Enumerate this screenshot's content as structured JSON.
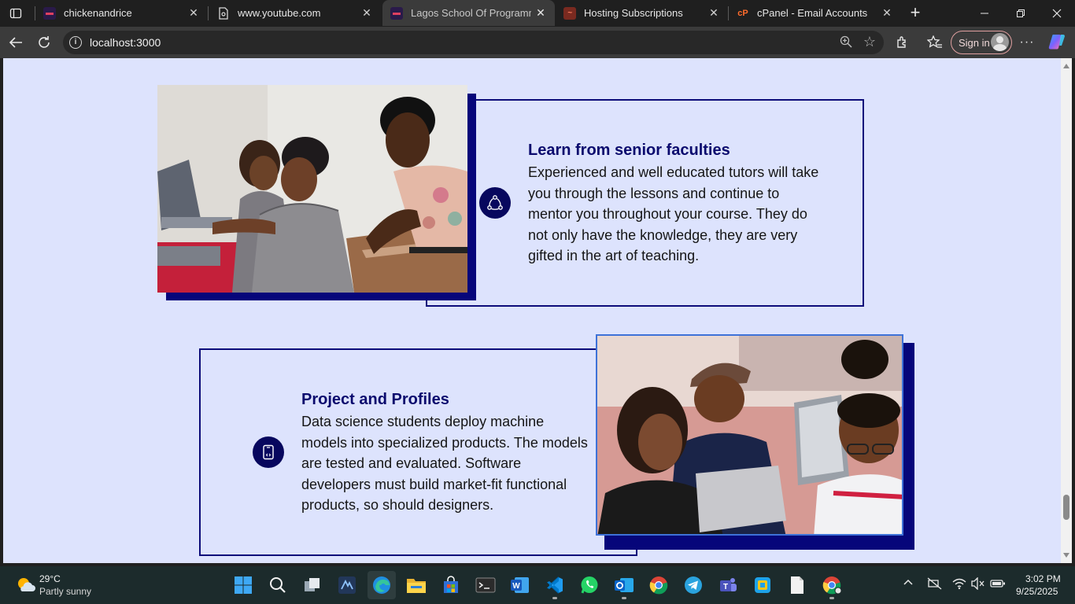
{
  "browser": {
    "tabs": [
      {
        "title": "chickenandrice",
        "favicon": "site-favicon-icon",
        "active": false
      },
      {
        "title": "www.youtube.com",
        "favicon": "page-icon",
        "active": false
      },
      {
        "title": "Lagos School Of Programming",
        "favicon": "site-favicon-icon",
        "active": true
      },
      {
        "title": "Hosting Subscriptions",
        "favicon": "hosting-favicon-icon",
        "active": false
      },
      {
        "title": "cPanel - Email Accounts",
        "favicon": "cpanel-favicon-icon",
        "active": false
      }
    ],
    "close_glyph": "✕",
    "url": "localhost:3000",
    "signin_label": "Sign in",
    "colors": {
      "accent": "#0c0c7a",
      "page_bg": "#dde3fd",
      "toolbar": "#3b3b3b"
    }
  },
  "page": {
    "cards": [
      {
        "title": "Learn from senior faculties",
        "body": "Experienced and well educated tutors will take you through the lessons and continue to mentor you throughout your course. They do not only have the knowledge, they are very gifted in the art of teaching.",
        "icon": "network-icon",
        "photo": "tutor-mentoring-students-photo"
      },
      {
        "title": "Project and Profiles",
        "body": "Data science students deploy machine models into specialized products. The models are tested and evaluated. Software developers must build market-fit functional products, so should designers.",
        "icon": "tablet-code-icon",
        "photo": "students-with-laptop-photo"
      }
    ]
  },
  "taskbar": {
    "weather": {
      "temp": "29°C",
      "desc": "Partly sunny"
    },
    "apps": [
      "start-icon",
      "search-icon",
      "task-view-icon",
      "anydesk-icon",
      "edge-icon",
      "file-explorer-icon",
      "store-icon",
      "terminal-icon",
      "word-icon",
      "vscode-icon",
      "whatsapp-icon",
      "outlook-icon",
      "chrome-icon",
      "telegram-icon",
      "teams-icon",
      "photos-icon",
      "notepad-icon",
      "chrome-profile-icon"
    ],
    "clock": {
      "time": "3:02 PM",
      "date": "9/25/2025"
    }
  }
}
